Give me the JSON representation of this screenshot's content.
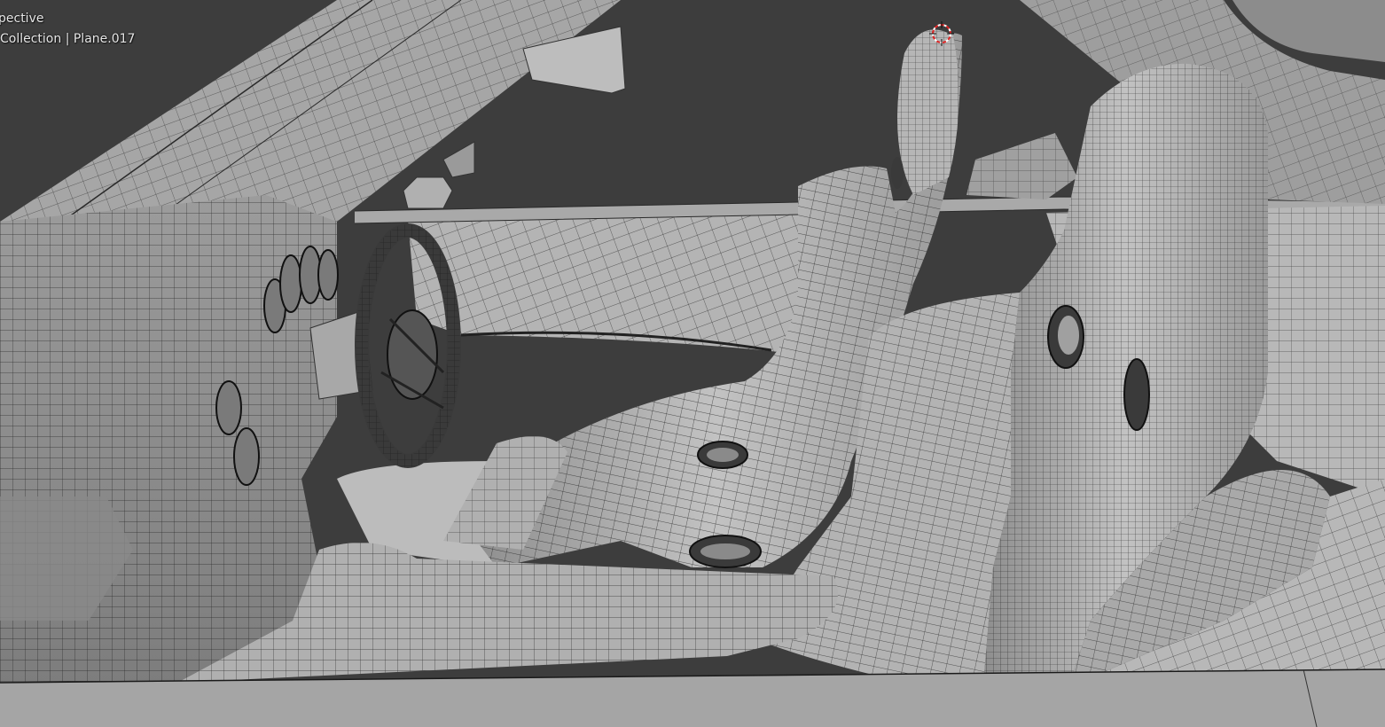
{
  "viewport": {
    "view_label": "pective",
    "object_info": "Collection | Plane.017",
    "background_color": "#3d3d3d",
    "mesh_color": "#a8a8a8",
    "wire_color": "#1a1a1a"
  },
  "icons": {
    "cursor": "3d-cursor-icon"
  }
}
